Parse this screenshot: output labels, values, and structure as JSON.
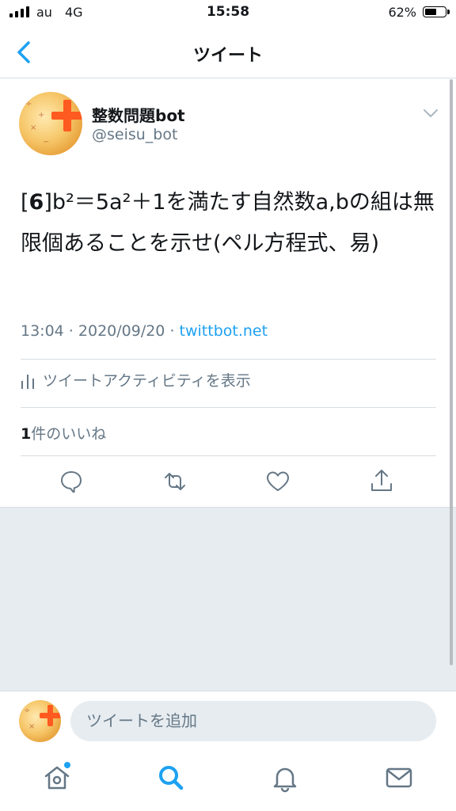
{
  "status_bar": {
    "carrier": "au",
    "network": "4G",
    "time": "15:58",
    "battery_percent": "62%",
    "battery_level": 0.62
  },
  "nav": {
    "back_icon": "chevron-left-icon",
    "title": "ツイート"
  },
  "tweet": {
    "display_name": "整数問題bot",
    "handle": "@seisu_bot",
    "text_prefix": "[",
    "text_number": "6",
    "text_body": "]b²＝5a²＋1を満たす自然数a,bの組は無限個あることを示せ(ペル方程式、易)",
    "time": "13:04",
    "date": "2020/09/20",
    "separator": " · ",
    "source": "twittbot.net",
    "activity_label": "ツイートアクティビティを表示",
    "likes_count": "1",
    "likes_label": "件のいいね"
  },
  "actions": [
    {
      "icon": "reply-icon"
    },
    {
      "icon": "retweet-icon"
    },
    {
      "icon": "like-icon"
    },
    {
      "icon": "share-icon"
    }
  ],
  "composer": {
    "placeholder": "ツイートを追加"
  },
  "tabbar": {
    "items": [
      "home-icon",
      "search-icon",
      "notifications-icon",
      "messages-icon"
    ],
    "accent": "#1da1f2"
  },
  "colors": {
    "accent": "#1da1f2",
    "secondary_text": "#657786",
    "divider": "#d7dde2",
    "background_gray": "#e6ecf0"
  }
}
